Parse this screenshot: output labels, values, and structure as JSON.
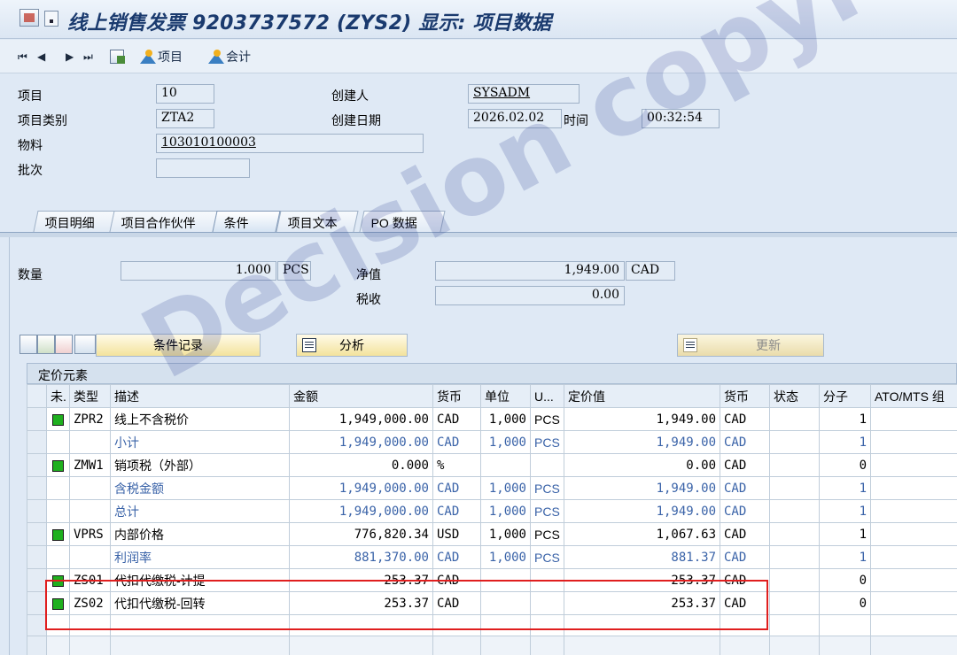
{
  "window": {
    "title": "线上销售发票 9203737572 (ZYS2) 显示: 项目数据"
  },
  "toolbar": {
    "nav_first": "⏮",
    "nav_prev": "◀",
    "nav_next": "▶",
    "nav_last": "⏭",
    "item_btn": "项目",
    "account_btn": "会计"
  },
  "header": {
    "item_label": "项目",
    "item_value": "10",
    "created_by_label": "创建人",
    "created_by_value": "SYSADM",
    "item_cat_label": "项目类别",
    "item_cat_value": "ZTA2",
    "created_on_label": "创建日期",
    "created_on_value": "2026.02.02",
    "time_label": "时间",
    "time_value": "00:32:54",
    "material_label": "物料",
    "material_value": "103010100003",
    "batch_label": "批次",
    "batch_value": ""
  },
  "tabs": [
    {
      "label": "项目明细"
    },
    {
      "label": "项目合作伙伴"
    },
    {
      "label": "条件"
    },
    {
      "label": "项目文本"
    },
    {
      "label": "PO 数据"
    }
  ],
  "conditions": {
    "qty_label": "数量",
    "qty_value": "1.000",
    "qty_unit": "PCS",
    "net_label": "净值",
    "net_value": "1,949.00",
    "net_curr": "CAD",
    "tax_label": "税收",
    "tax_value": "0.00",
    "cond_record_btn": "条件记录",
    "analysis_btn": "分析",
    "update_btn": "更新",
    "grid_title": "定价元素",
    "columns": [
      "未.",
      "类型",
      "描述",
      "金额",
      "货币",
      "单位",
      "U...",
      "定价值",
      "货币",
      "状态",
      "分子",
      "ATO/MTS 组"
    ],
    "rows": [
      {
        "inactive": true,
        "type": "ZPR2",
        "desc": "线上不含税价",
        "amount": "1,949,000.00",
        "curr": "CAD",
        "per": "1,000",
        "uom": "PCS",
        "value": "1,949.00",
        "vcurr": "CAD",
        "status": "",
        "num": "1",
        "sub": false
      },
      {
        "inactive": false,
        "type": "",
        "desc": "小计",
        "amount": "1,949,000.00",
        "curr": "CAD",
        "per": "1,000",
        "uom": "PCS",
        "value": "1,949.00",
        "vcurr": "CAD",
        "status": "",
        "num": "1",
        "sub": true
      },
      {
        "inactive": true,
        "type": "ZMW1",
        "desc": "销项税（外部）",
        "amount": "0.000",
        "curr": "%",
        "per": "",
        "uom": "",
        "value": "0.00",
        "vcurr": "CAD",
        "status": "",
        "num": "0",
        "sub": false
      },
      {
        "inactive": false,
        "type": "",
        "desc": "含税金额",
        "amount": "1,949,000.00",
        "curr": "CAD",
        "per": "1,000",
        "uom": "PCS",
        "value": "1,949.00",
        "vcurr": "CAD",
        "status": "",
        "num": "1",
        "sub": true
      },
      {
        "inactive": false,
        "type": "",
        "desc": "总计",
        "amount": "1,949,000.00",
        "curr": "CAD",
        "per": "1,000",
        "uom": "PCS",
        "value": "1,949.00",
        "vcurr": "CAD",
        "status": "",
        "num": "1",
        "sub": true
      },
      {
        "inactive": true,
        "type": "VPRS",
        "desc": "内部价格",
        "amount": "776,820.34",
        "curr": "USD",
        "per": "1,000",
        "uom": "PCS",
        "value": "1,067.63",
        "vcurr": "CAD",
        "status": "",
        "num": "1",
        "sub": false
      },
      {
        "inactive": false,
        "type": "",
        "desc": "利润率",
        "amount": "881,370.00",
        "curr": "CAD",
        "per": "1,000",
        "uom": "PCS",
        "value": "881.37",
        "vcurr": "CAD",
        "status": "",
        "num": "1",
        "sub": true
      },
      {
        "inactive": true,
        "type": "ZS01",
        "desc": "代扣代缴税-计提",
        "amount": "253.37",
        "curr": "CAD",
        "per": "",
        "uom": "",
        "value": "253.37",
        "vcurr": "CAD",
        "status": "",
        "num": "0",
        "sub": false
      },
      {
        "inactive": true,
        "type": "ZS02",
        "desc": "代扣代缴税-回转",
        "amount": "253.37",
        "curr": "CAD",
        "per": "",
        "uom": "",
        "value": "253.37",
        "vcurr": "CAD",
        "status": "",
        "num": "0",
        "sub": false
      }
    ]
  },
  "watermark": "Decision copyright",
  "colors": {
    "accent": "#1a3a6e",
    "subtotal_text": "#3a63a8",
    "highlight": "#e01e1e",
    "status_green": "#1fb01f"
  }
}
